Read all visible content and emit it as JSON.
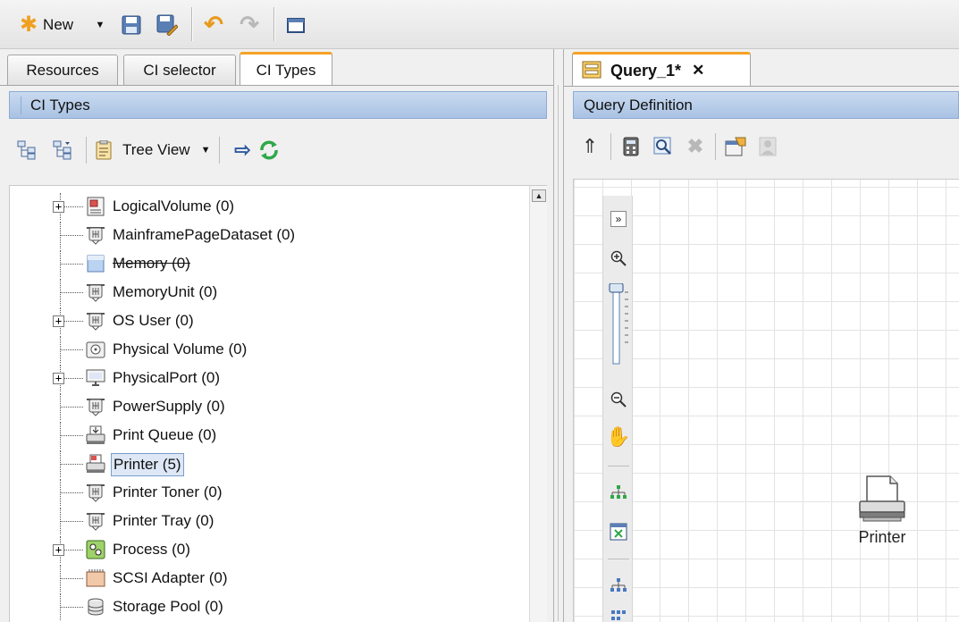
{
  "toolbar": {
    "new_label": "New",
    "icons": [
      "new-star-icon",
      "dropdown-arrow-icon",
      "save-icon",
      "save-as-icon",
      "undo-icon",
      "redo-icon",
      "window-icon"
    ]
  },
  "left_panel": {
    "tabs": [
      {
        "label": "Resources"
      },
      {
        "label": "CI selector"
      },
      {
        "label": "CI Types",
        "active": true
      }
    ],
    "header": "CI Types",
    "subtoolbar": {
      "view_label": "Tree View"
    },
    "tree": [
      {
        "label": "LogicalVolume (0)",
        "expandable": true,
        "icon": "logical-volume-icon"
      },
      {
        "label": "MainframePageDataset (0)",
        "expandable": false,
        "icon": "component-icon"
      },
      {
        "label": "Memory (0)",
        "expandable": false,
        "icon": "memory-icon",
        "strikethrough": true
      },
      {
        "label": "MemoryUnit (0)",
        "expandable": false,
        "icon": "component-icon"
      },
      {
        "label": "OS User (0)",
        "expandable": true,
        "icon": "component-icon"
      },
      {
        "label": "Physical Volume (0)",
        "expandable": false,
        "icon": "physical-volume-icon"
      },
      {
        "label": "PhysicalPort (0)",
        "expandable": true,
        "icon": "monitor-icon"
      },
      {
        "label": "PowerSupply (0)",
        "expandable": false,
        "icon": "component-icon"
      },
      {
        "label": "Print Queue (0)",
        "expandable": false,
        "icon": "print-queue-icon"
      },
      {
        "label": "Printer (5)",
        "expandable": false,
        "icon": "printer-icon",
        "selected": true
      },
      {
        "label": "Printer Toner (0)",
        "expandable": false,
        "icon": "component-icon"
      },
      {
        "label": "Printer Tray (0)",
        "expandable": false,
        "icon": "component-icon"
      },
      {
        "label": "Process (0)",
        "expandable": true,
        "icon": "process-icon"
      },
      {
        "label": "SCSI Adapter (0)",
        "expandable": false,
        "icon": "scsi-adapter-icon"
      },
      {
        "label": "Storage Pool (0)",
        "expandable": false,
        "icon": "storage-pool-icon"
      }
    ]
  },
  "right_panel": {
    "tab_label": "Query_1*",
    "close_glyph": "✕",
    "header": "Query Definition",
    "node_label": "Printer"
  },
  "colors": {
    "header_blue": "#b7cdea",
    "active_tab_accent": "#f5a227",
    "selection": "#dde7f5"
  }
}
